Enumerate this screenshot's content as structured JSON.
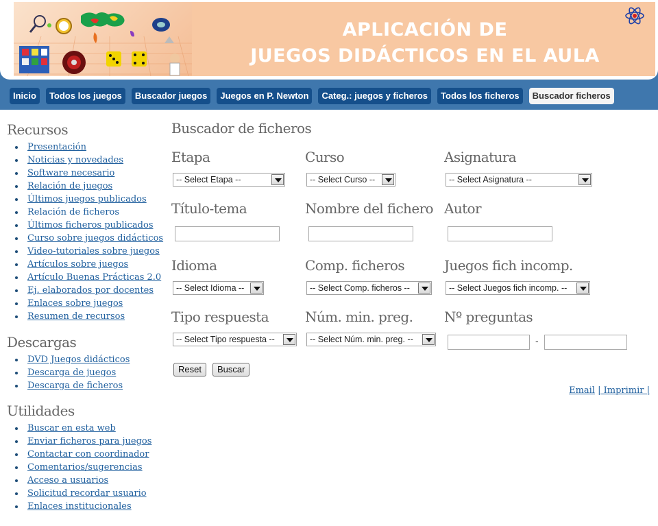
{
  "banner": {
    "title_line1": "APLICACIÓN DE",
    "title_line2": "JUEGOS DIDÁCTICOS EN EL AULA"
  },
  "nav": {
    "items": [
      "Inicio",
      "Todos los juegos",
      "Buscador juegos",
      "Juegos en P. Newton",
      "Categ.: juegos y ficheros",
      "Todos los ficheros",
      "Buscador ficheros"
    ],
    "active": "Buscador ficheros"
  },
  "sidebar": {
    "recursos": {
      "heading": "Recursos",
      "items": [
        "Presentación",
        "Noticias y novedades",
        "Software necesario",
        "Relación de juegos",
        "Últimos juegos publicados",
        "Relación de ficheros",
        "Últimos ficheros publicados",
        "Curso sobre juegos didácticos",
        "Video-tutoriales sobre juegos",
        "Artículos sobre juegos",
        "Artículo Buenas Prácticas 2.0",
        "Ej. elaborados por docentes",
        "Enlaces sobre juegos",
        "Resumen de recursos"
      ]
    },
    "descargas": {
      "heading": "Descargas",
      "items": [
        "DVD Juegos didácticos",
        "Descarga de juegos",
        "Descarga de ficheros"
      ]
    },
    "utilidades": {
      "heading": "Utilidades",
      "items": [
        "Buscar en esta web",
        "Enviar ficheros para juegos",
        "Contactar con coordinador",
        "Comentarios/sugerencias",
        "Acceso a usuarios",
        "Solicitud recordar usuario",
        "Enlaces institucionales"
      ]
    }
  },
  "main": {
    "title": "Buscador de ficheros",
    "fields": {
      "etapa": {
        "label": "Etapa",
        "value": "-- Select Etapa --"
      },
      "curso": {
        "label": "Curso",
        "value": "-- Select Curso --"
      },
      "asignatura": {
        "label": "Asignatura",
        "value": "-- Select Asignatura --"
      },
      "titulo": {
        "label": "Título-tema",
        "value": ""
      },
      "nombre": {
        "label": "Nombre del fichero",
        "value": ""
      },
      "autor": {
        "label": "Autor",
        "value": ""
      },
      "idioma": {
        "label": "Idioma",
        "value": "-- Select Idioma --"
      },
      "comp": {
        "label": "Comp. ficheros",
        "value": "-- Select Comp. ficheros --"
      },
      "incomp": {
        "label": "Juegos fich incomp.",
        "value": "-- Select Juegos fich incomp. --"
      },
      "tipo": {
        "label": "Tipo respuesta",
        "value": "-- Select Tipo respuesta --"
      },
      "minpreg": {
        "label": "Núm. min. preg.",
        "value": "-- Select Núm. min. preg. --"
      },
      "npreg": {
        "label": "Nº preguntas",
        "from": "",
        "to": "",
        "separator": "-"
      }
    },
    "buttons": {
      "reset": "Reset",
      "buscar": "Buscar"
    },
    "footer": {
      "email": "Email",
      "imprimir": "| Imprimir |"
    }
  }
}
